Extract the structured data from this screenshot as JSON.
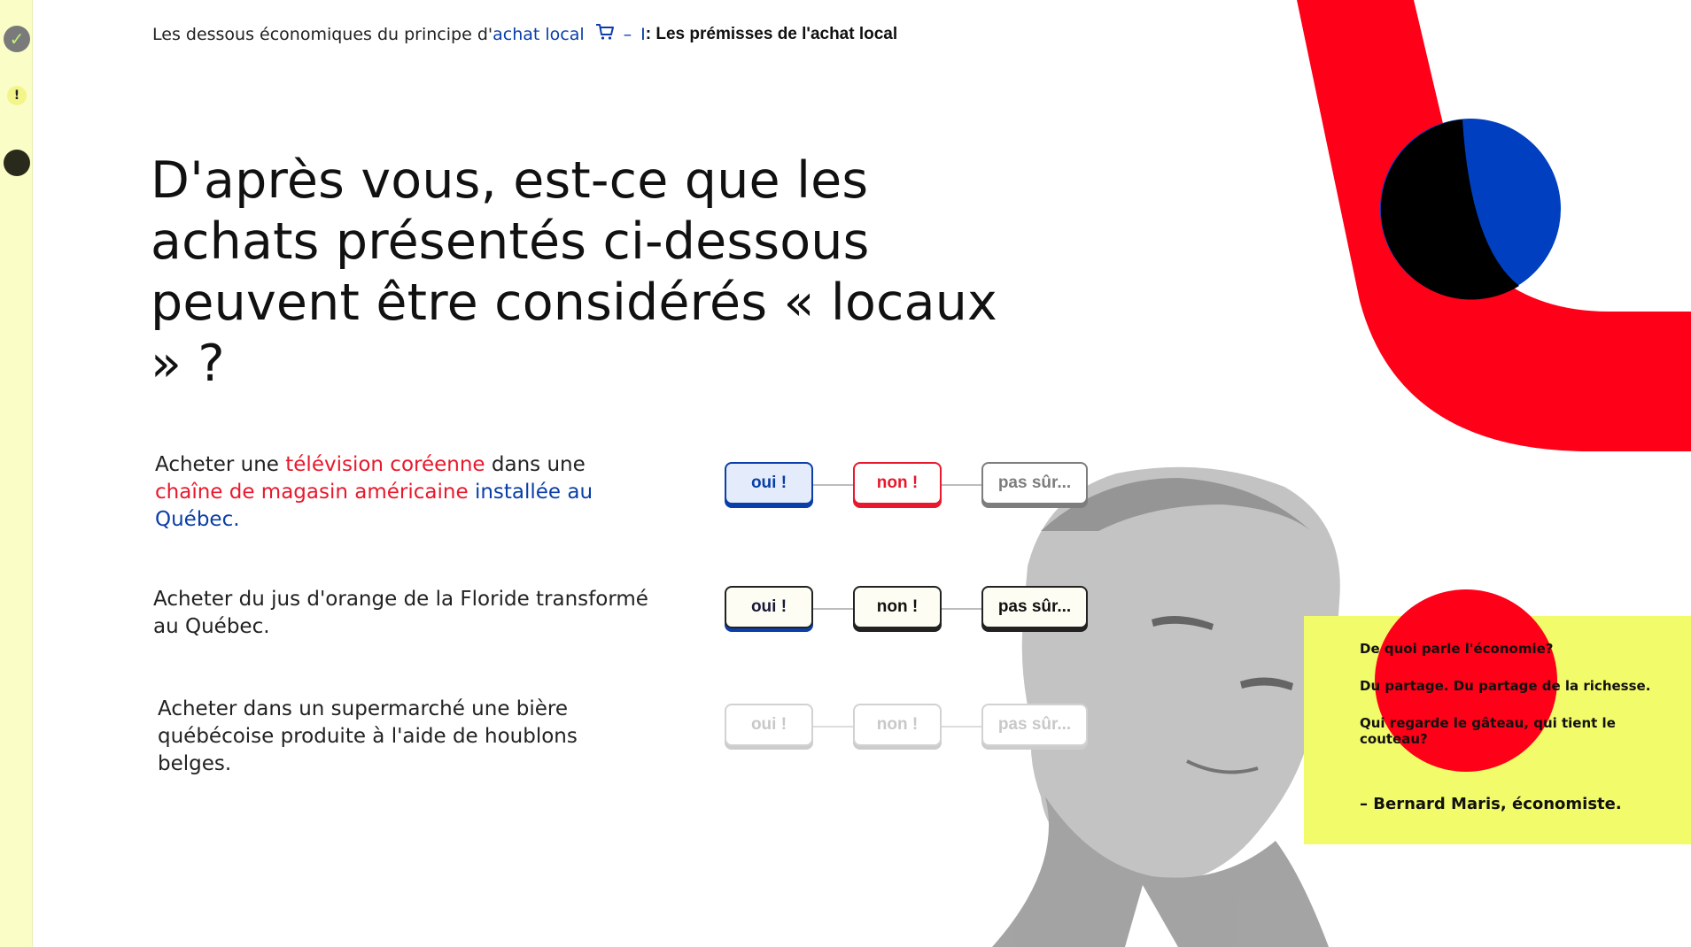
{
  "breadcrumb": {
    "prefix": "Les dessous économiques du principe d'",
    "link": "achat local",
    "separator": "–",
    "section_number": "I",
    "section_title": ": Les prémisses de l'achat local"
  },
  "title": "D'après vous, est-ce que les achats présentés ci-dessous peuvent être considérés « locaux » ?",
  "questions": [
    {
      "parts": [
        "Acheter une ",
        "télévision coréenne",
        " dans une ",
        "chaîne de magasin américaine",
        " ",
        "installée au Québec."
      ]
    },
    {
      "parts": [
        "Acheter du jus d'orange de la Floride transformé au Québec."
      ]
    },
    {
      "parts": [
        "Acheter dans un supermarché une bière québécoise produite à l'aide de houblons belges."
      ]
    }
  ],
  "answers": {
    "yes_label": "oui !",
    "no_label": "non !",
    "unsure_label": "pas sûr..."
  },
  "quote": {
    "line1": "De quoi parle l'économie?",
    "line2": "Du partage. Du partage de la richesse.",
    "line3": "Qui regarde le gâteau, qui tient le couteau?",
    "author": "– Bernard Maris, économiste."
  },
  "colors": {
    "accent_red": "#e8192c",
    "accent_blue": "#0a3ea8",
    "accent_yellow": "#f2fb6a",
    "rail_yellow": "#fbfdc7"
  },
  "icons": {
    "progress_complete": "checkmark-icon",
    "progress_warning": "exclamation-icon",
    "progress_current": "dot-icon",
    "breadcrumb_link": "shopping-cart-icon"
  }
}
